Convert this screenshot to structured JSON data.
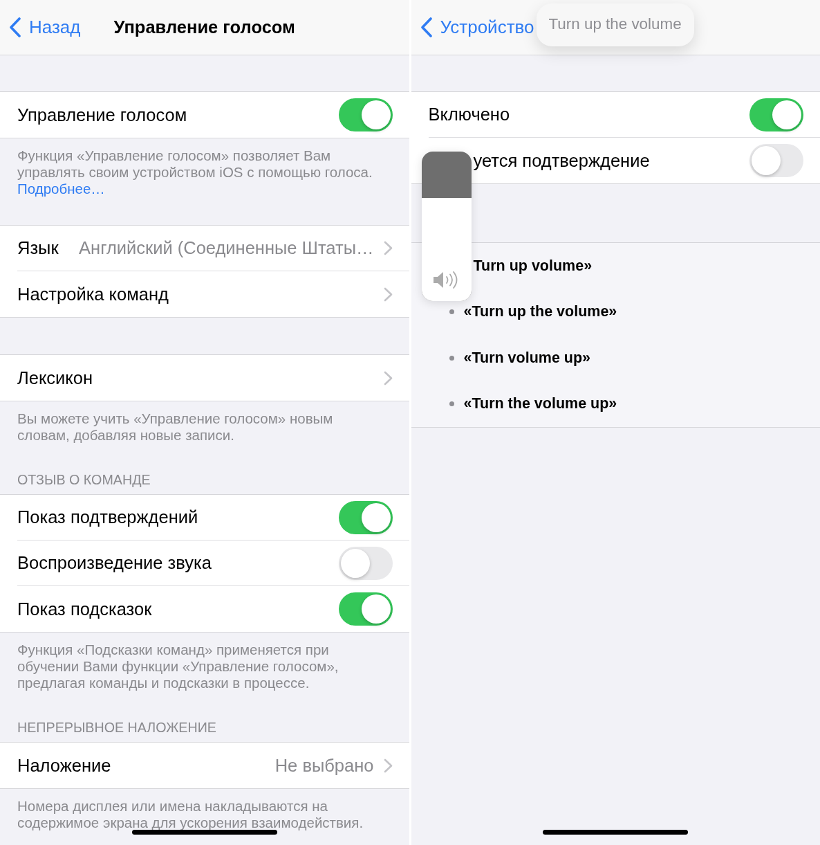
{
  "screens": [
    {
      "nav": {
        "back": "Назад",
        "title": "Управление голосом"
      },
      "sections": [
        {
          "rows": [
            {
              "kind": "toggle",
              "label": "Управление голосом",
              "on": true
            }
          ],
          "footer": "Функция «Управление голосом» позволяет Вам управлять своим устройством iOS с помощью голоса.",
          "footer_link": "Подробнее…"
        },
        {
          "rows": [
            {
              "kind": "value",
              "label": "Язык",
              "value": "Английский (Соединенные Штаты…"
            },
            {
              "kind": "link",
              "label": "Настройка команд"
            }
          ]
        },
        {
          "rows": [
            {
              "kind": "link",
              "label": "Лексикон"
            }
          ],
          "footer": "Вы можете учить «Управление голосом» новым словам, добавляя новые записи."
        },
        {
          "header": "ОТЗЫВ О КОМАНДЕ",
          "rows": [
            {
              "kind": "toggle",
              "label": "Показ подтверждений",
              "on": true
            },
            {
              "kind": "toggle",
              "label": "Воспроизведение звука",
              "on": false
            },
            {
              "kind": "toggle",
              "label": "Показ подсказок",
              "on": true
            }
          ],
          "footer": "Функция «Подсказки команд» применяется при обучении Вами функции «Управление голосом», предлагая команды и подсказки в процессе."
        },
        {
          "header": "НЕПРЕРЫВНОЕ НАЛОЖЕНИЕ",
          "rows": [
            {
              "kind": "value",
              "label": "Наложение",
              "value": "Не выбрано"
            }
          ],
          "footer": "Номера дисплея или имена накладываются на содержимое экрана для ускорения взаимодействия."
        }
      ]
    },
    {
      "nav": {
        "back": "Устройство"
      },
      "command_bubble": "Turn up the volume",
      "sections": [
        {
          "rows": [
            {
              "kind": "toggle",
              "label": "Включено",
              "on": true
            },
            {
              "kind": "toggle",
              "label": "уется подтверждение",
              "on": false
            }
          ]
        },
        {
          "rows": [
            {
              "kind": "phrase",
              "label": "Turn up volume»"
            },
            {
              "kind": "phrase",
              "label": "«Turn up the volume»"
            },
            {
              "kind": "phrase",
              "label": "«Turn volume up»"
            },
            {
              "kind": "phrase",
              "label": "«Turn the volume up»"
            }
          ]
        }
      ],
      "volume_hud": {
        "level": 0.69
      }
    }
  ]
}
